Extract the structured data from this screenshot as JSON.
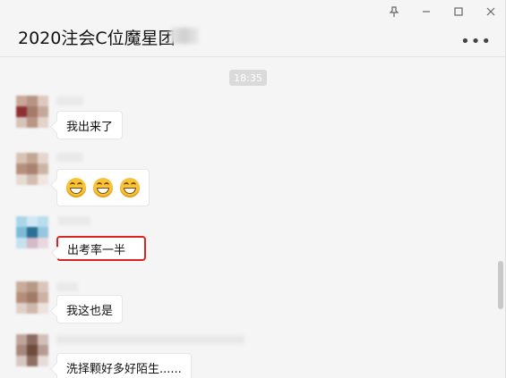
{
  "window": {
    "title": "2020注会C位魔星团",
    "controls": [
      "pin-icon",
      "minimize-icon",
      "maximize-icon",
      "close-icon"
    ],
    "more_label": "•••"
  },
  "chat": {
    "timestamp": "18:35",
    "messages": [
      {
        "text": "我出来了"
      },
      {
        "text": "",
        "emoji": [
          "grin-emoji",
          "grin-emoji",
          "grin-emoji"
        ]
      },
      {
        "text": "出考率一半",
        "highlighted": true
      },
      {
        "text": "我这也是"
      },
      {
        "text": "洗择颗好多好陌生......"
      }
    ]
  },
  "colors": {
    "highlight": "#d8231f",
    "background": "#f5f5f5",
    "bubble": "#ffffff"
  }
}
